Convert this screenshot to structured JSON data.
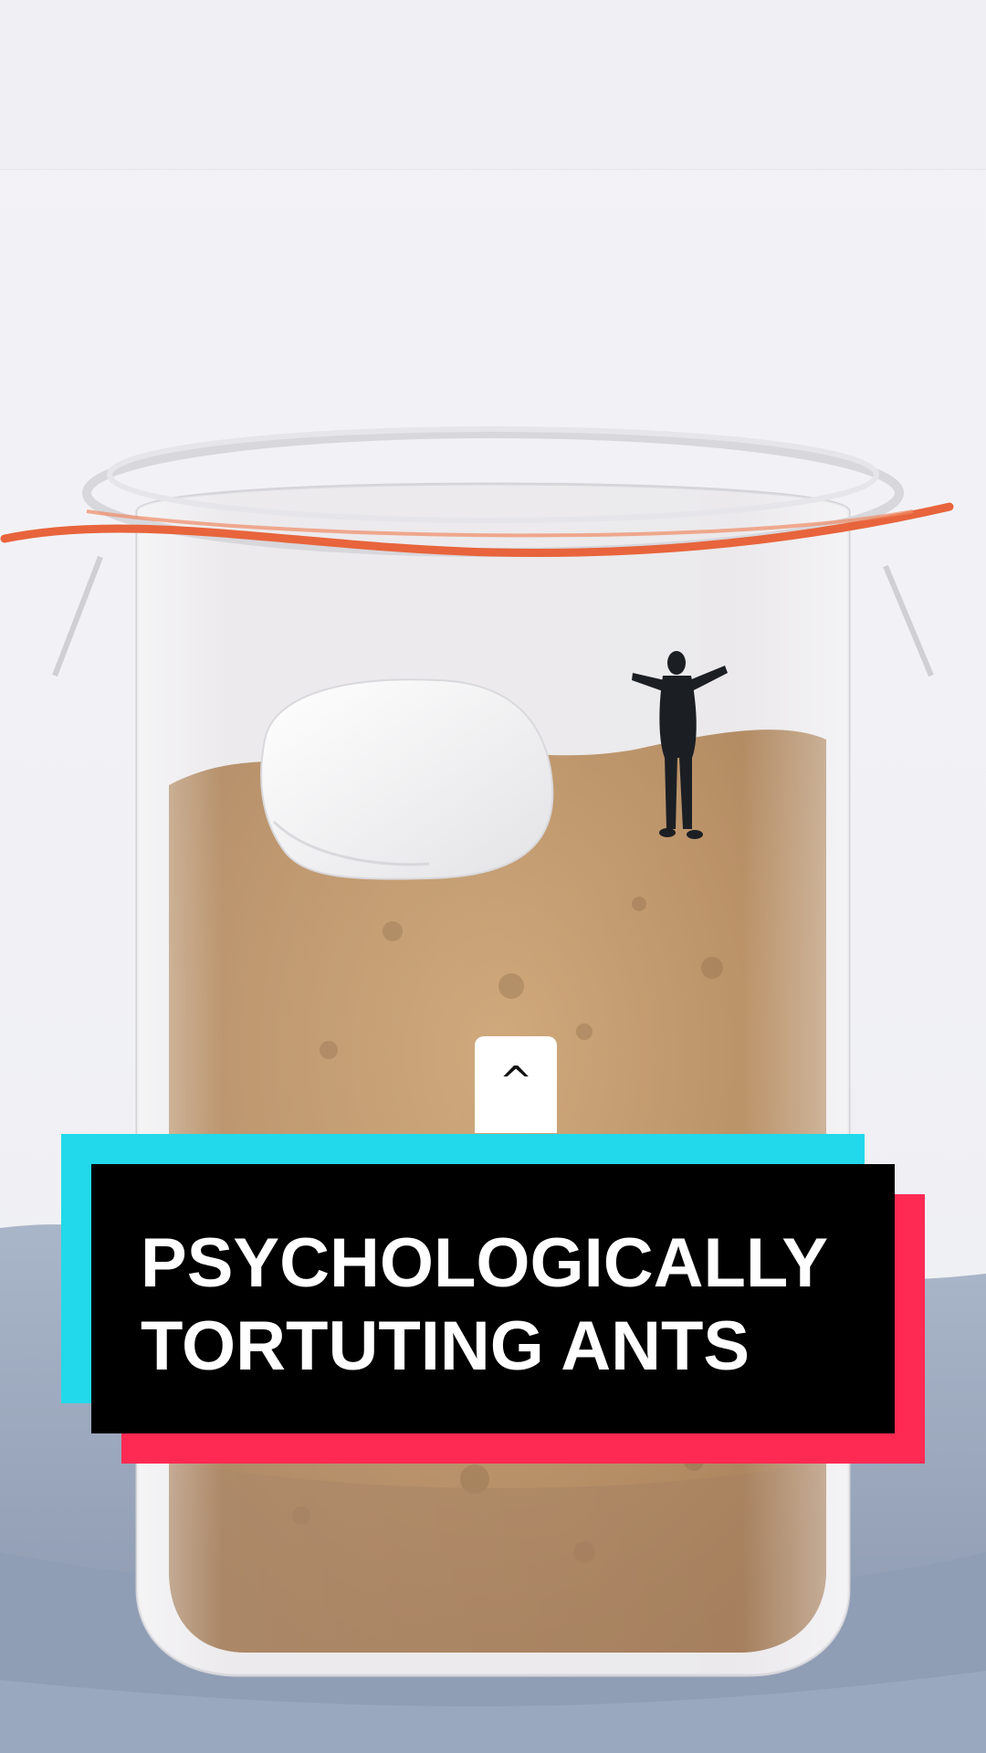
{
  "caption": {
    "text": "PSYCHOLOGICALLY\nTORTUTING ANTS"
  },
  "swipe_up": {
    "icon": "caret-up-icon",
    "glyph": "^"
  },
  "colors": {
    "caption_background": "#000000",
    "caption_text": "#ffffff",
    "accent_cyan": "#21d9ea",
    "accent_red": "#ff2a53",
    "jar_seal": "#e8643c",
    "brown_sugar": "#b98e5c"
  }
}
